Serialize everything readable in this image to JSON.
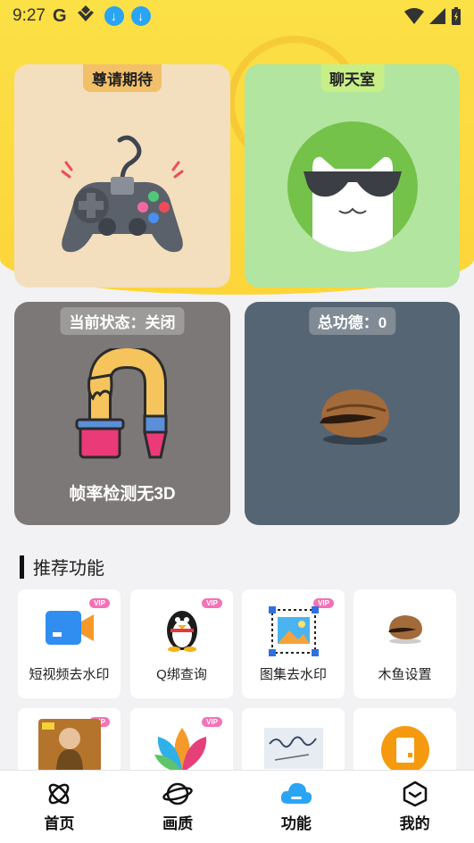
{
  "status_bar": {
    "time": "9:27",
    "g_label": "G"
  },
  "cards": {
    "game": {
      "tag": "尊请期待"
    },
    "chat": {
      "tag": "聊天室"
    },
    "status": {
      "tag": "当前状态：关闭",
      "caption": "帧率检测无3D"
    },
    "merit": {
      "tag": "总功德：0"
    }
  },
  "recommend": {
    "title": "推荐功能",
    "tiles": [
      {
        "label": "短视频去水印",
        "vip": "VIP"
      },
      {
        "label": "Q绑查询",
        "vip": "VIP"
      },
      {
        "label": "图集去水印",
        "vip": "VIP"
      },
      {
        "label": "木鱼设置"
      },
      {
        "label": "",
        "vip": "VIP"
      },
      {
        "label": "",
        "vip": "VIP"
      },
      {
        "label": ""
      },
      {
        "label": ""
      }
    ]
  },
  "nav": {
    "items": [
      {
        "label": "首页"
      },
      {
        "label": "画质"
      },
      {
        "label": "功能"
      },
      {
        "label": "我的"
      }
    ]
  },
  "colors": {
    "header_yellow": "#fbe046",
    "active_nav": "#2aa4f4"
  }
}
